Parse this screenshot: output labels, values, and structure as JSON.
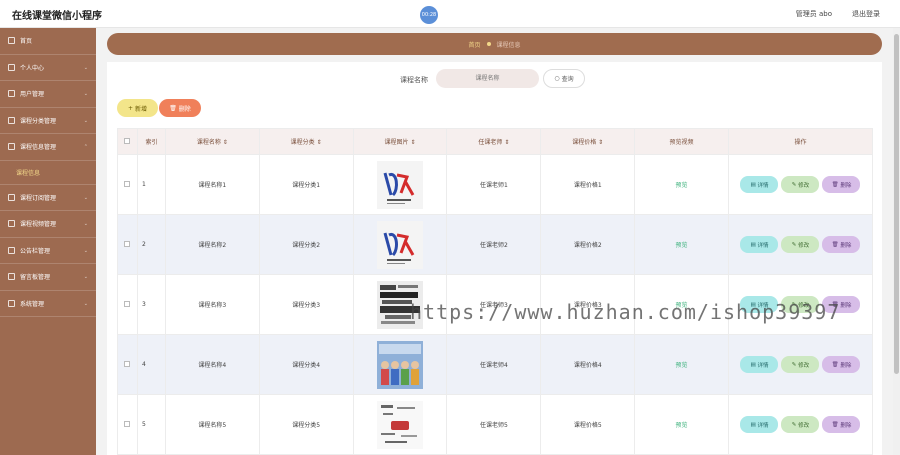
{
  "app": {
    "title": "在线课堂微信小程序",
    "avatar_text": "00:28"
  },
  "header": {
    "admin_label": "管理员 abo",
    "logout_label": "退出登录"
  },
  "sidebar": {
    "items": [
      {
        "label": "首页"
      },
      {
        "label": "个人中心"
      },
      {
        "label": "用户管理"
      },
      {
        "label": "课程分类管理"
      },
      {
        "label": "课程信息管理"
      },
      {
        "label": "课程订阅管理"
      },
      {
        "label": "课程视频管理"
      },
      {
        "label": "公告栏管理"
      },
      {
        "label": "留言板管理"
      },
      {
        "label": "系统管理"
      }
    ],
    "sub_active": "课程信息"
  },
  "breadcrumb": {
    "home": "首页",
    "current": "课程信息"
  },
  "search": {
    "label": "课程名称",
    "placeholder": "课程名称",
    "button": "查询"
  },
  "toolbar": {
    "add": "新增",
    "delete": "删除"
  },
  "table": {
    "headers": {
      "index": "索引",
      "name": "课程名称",
      "category": "课程分类",
      "image": "课程图片",
      "teacher": "任课老师",
      "price": "课程价格",
      "video": "预览视频",
      "ops": "操作"
    },
    "rows": [
      {
        "index": "1",
        "name": "课程名称1",
        "category": "课程分类1",
        "teacher": "任课老师1",
        "price": "课程价格1",
        "video": "预览"
      },
      {
        "index": "2",
        "name": "课程名称2",
        "category": "课程分类2",
        "teacher": "任课老师2",
        "price": "课程价格2",
        "video": "预览"
      },
      {
        "index": "3",
        "name": "课程名称3",
        "category": "课程分类3",
        "teacher": "任课老师3",
        "price": "课程价格3",
        "video": "预览"
      },
      {
        "index": "4",
        "name": "课程名称4",
        "category": "课程分类4",
        "teacher": "任课老师4",
        "price": "课程价格4",
        "video": "预览"
      },
      {
        "index": "5",
        "name": "课程名称5",
        "category": "课程分类5",
        "teacher": "任课老师5",
        "price": "课程价格5",
        "video": "预览"
      }
    ],
    "op_labels": {
      "detail": "详情",
      "edit": "修改",
      "delete": "删除"
    }
  },
  "watermark": "https://www.huzhan.com/ishop39397",
  "colors": {
    "sidebar": "#9d6a50",
    "accent": "#f3d88a"
  }
}
